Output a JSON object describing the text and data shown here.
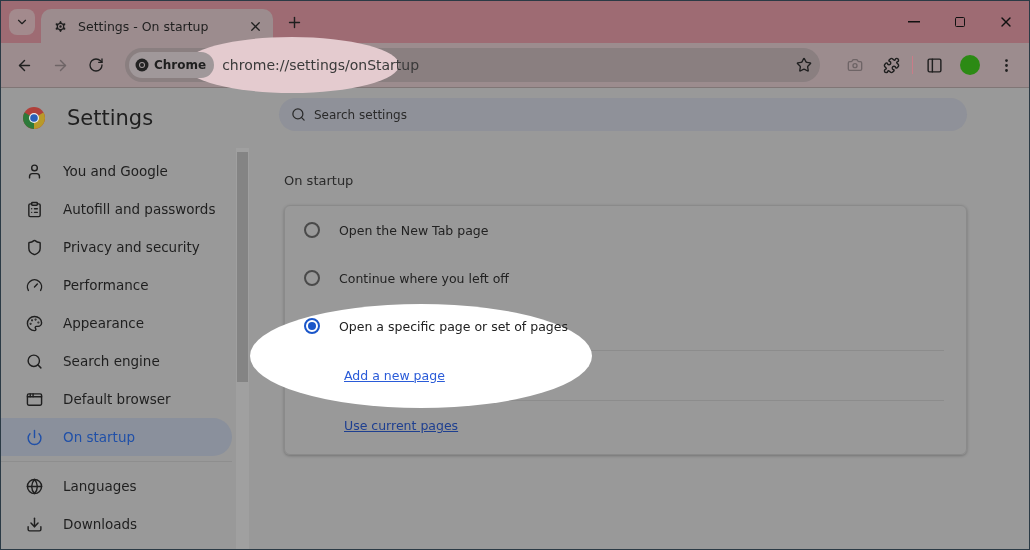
{
  "tabs": [
    {
      "title": "Settings - On startup",
      "selected": true
    }
  ],
  "address_bar": {
    "chip": "Chrome",
    "url": "chrome://settings/onStartup"
  },
  "header": {
    "title": "Settings"
  },
  "search": {
    "placeholder": "Search settings"
  },
  "sidebar": {
    "items": [
      {
        "label": "You and Google",
        "selected": false
      },
      {
        "label": "Autofill and passwords",
        "selected": false
      },
      {
        "label": "Privacy and security",
        "selected": false
      },
      {
        "label": "Performance",
        "selected": false
      },
      {
        "label": "Appearance",
        "selected": false
      },
      {
        "label": "Search engine",
        "selected": false
      },
      {
        "label": "Default browser",
        "selected": false
      },
      {
        "label": "On startup",
        "selected": true
      },
      {
        "label": "Languages",
        "selected": false
      },
      {
        "label": "Downloads",
        "selected": false
      }
    ]
  },
  "section": {
    "title": "On startup",
    "options": [
      {
        "label": "Open the New Tab page",
        "selected": false
      },
      {
        "label": "Continue where you left off",
        "selected": false
      },
      {
        "label": "Open a specific page or set of pages",
        "selected": true
      }
    ],
    "links": [
      "Add a new page",
      "Use current pages"
    ]
  }
}
